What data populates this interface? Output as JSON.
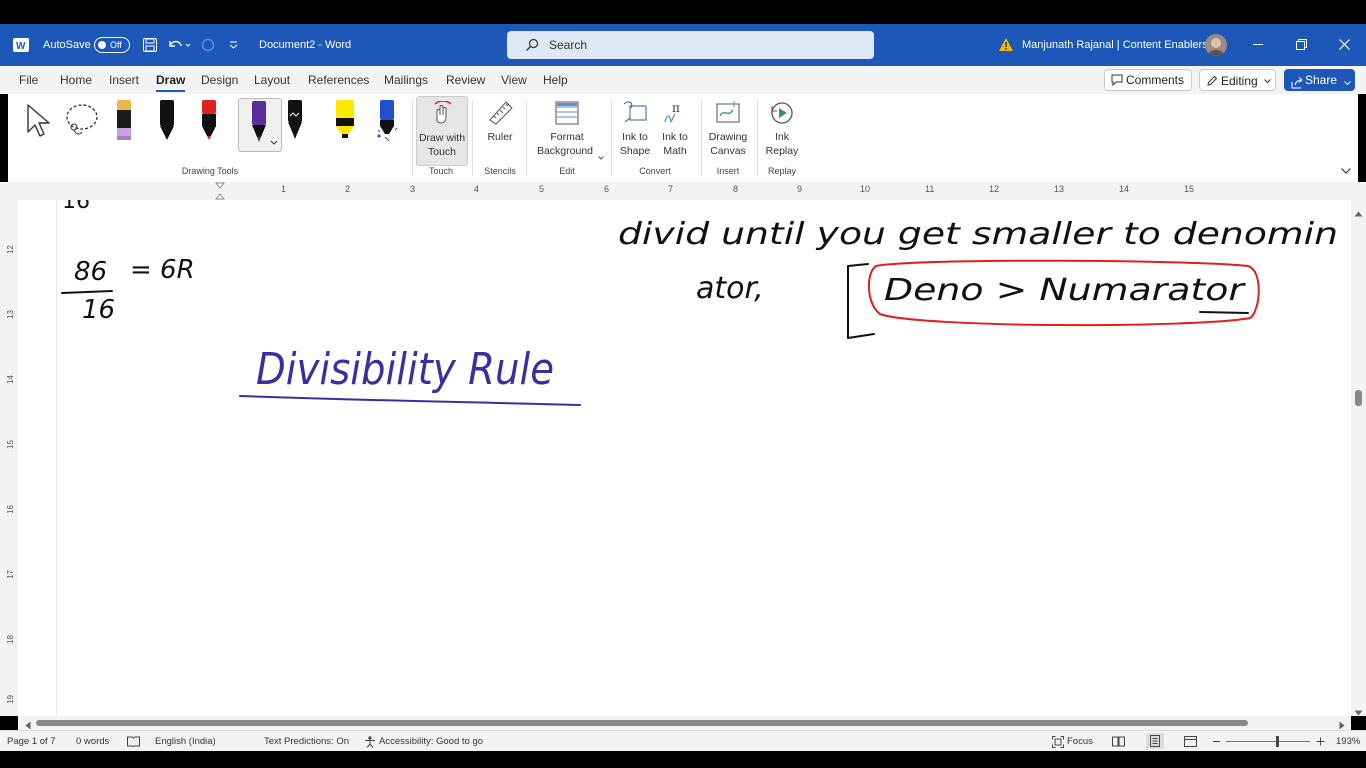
{
  "titlebar": {
    "autosave_label": "AutoSave",
    "autosave_state": "Off",
    "doc_title": "Document2 - Word",
    "search_placeholder": "Search",
    "user_name": "Manjunath Rajanal | Content Enablers"
  },
  "menu": {
    "items": [
      "File",
      "Home",
      "Insert",
      "Draw",
      "Design",
      "Layout",
      "References",
      "Mailings",
      "Review",
      "View",
      "Help"
    ],
    "active": "Draw",
    "comments_label": "Comments",
    "editing_label": "Editing",
    "share_label": "Share"
  },
  "ribbon": {
    "groups": {
      "drawing_tools": "Drawing Tools",
      "touch": "Touch",
      "stencils": "Stencils",
      "edit": "Edit",
      "convert": "Convert",
      "insert": "Insert",
      "replay": "Replay"
    },
    "buttons": {
      "draw_with_touch": [
        "Draw with",
        "Touch"
      ],
      "ruler": "Ruler",
      "format_background": [
        "Format",
        "Background"
      ],
      "ink_to_shape": [
        "Ink to",
        "Shape"
      ],
      "ink_to_math": [
        "Ink to",
        "Math"
      ],
      "drawing_canvas": [
        "Drawing",
        "Canvas"
      ],
      "ink_replay": [
        "Ink",
        "Replay"
      ]
    },
    "pen_colors": [
      "#f0b8c8",
      "#111111",
      "#e02020",
      "#5a2d9a",
      "#111111",
      "#ffe800",
      "#2050d0"
    ]
  },
  "ruler": {
    "numbers": [
      "1",
      "2",
      "3",
      "4",
      "5",
      "6",
      "7",
      "8",
      "9",
      "10",
      "11",
      "12",
      "13",
      "14",
      "15"
    ],
    "vertical_numbers": [
      "12",
      "13",
      "14",
      "15",
      "16",
      "17",
      "18",
      "19"
    ]
  },
  "document": {
    "ink_top_fragment": "16",
    "ink_line1": "divid until you get smaller to denomin",
    "ink_line2": "ator,",
    "ink_boxed": "Deno > Numarator",
    "ink_equation_num": "86",
    "ink_equation_den": "16",
    "ink_equation_result": "= 6R",
    "ink_heading": "Divisibility Rule"
  },
  "status": {
    "page": "Page 1 of 7",
    "words": "0 words",
    "language": "English (India)",
    "text_predictions": "Text Predictions: On",
    "accessibility": "Accessibility: Good to go",
    "focus": "Focus",
    "zoom": "193%"
  }
}
